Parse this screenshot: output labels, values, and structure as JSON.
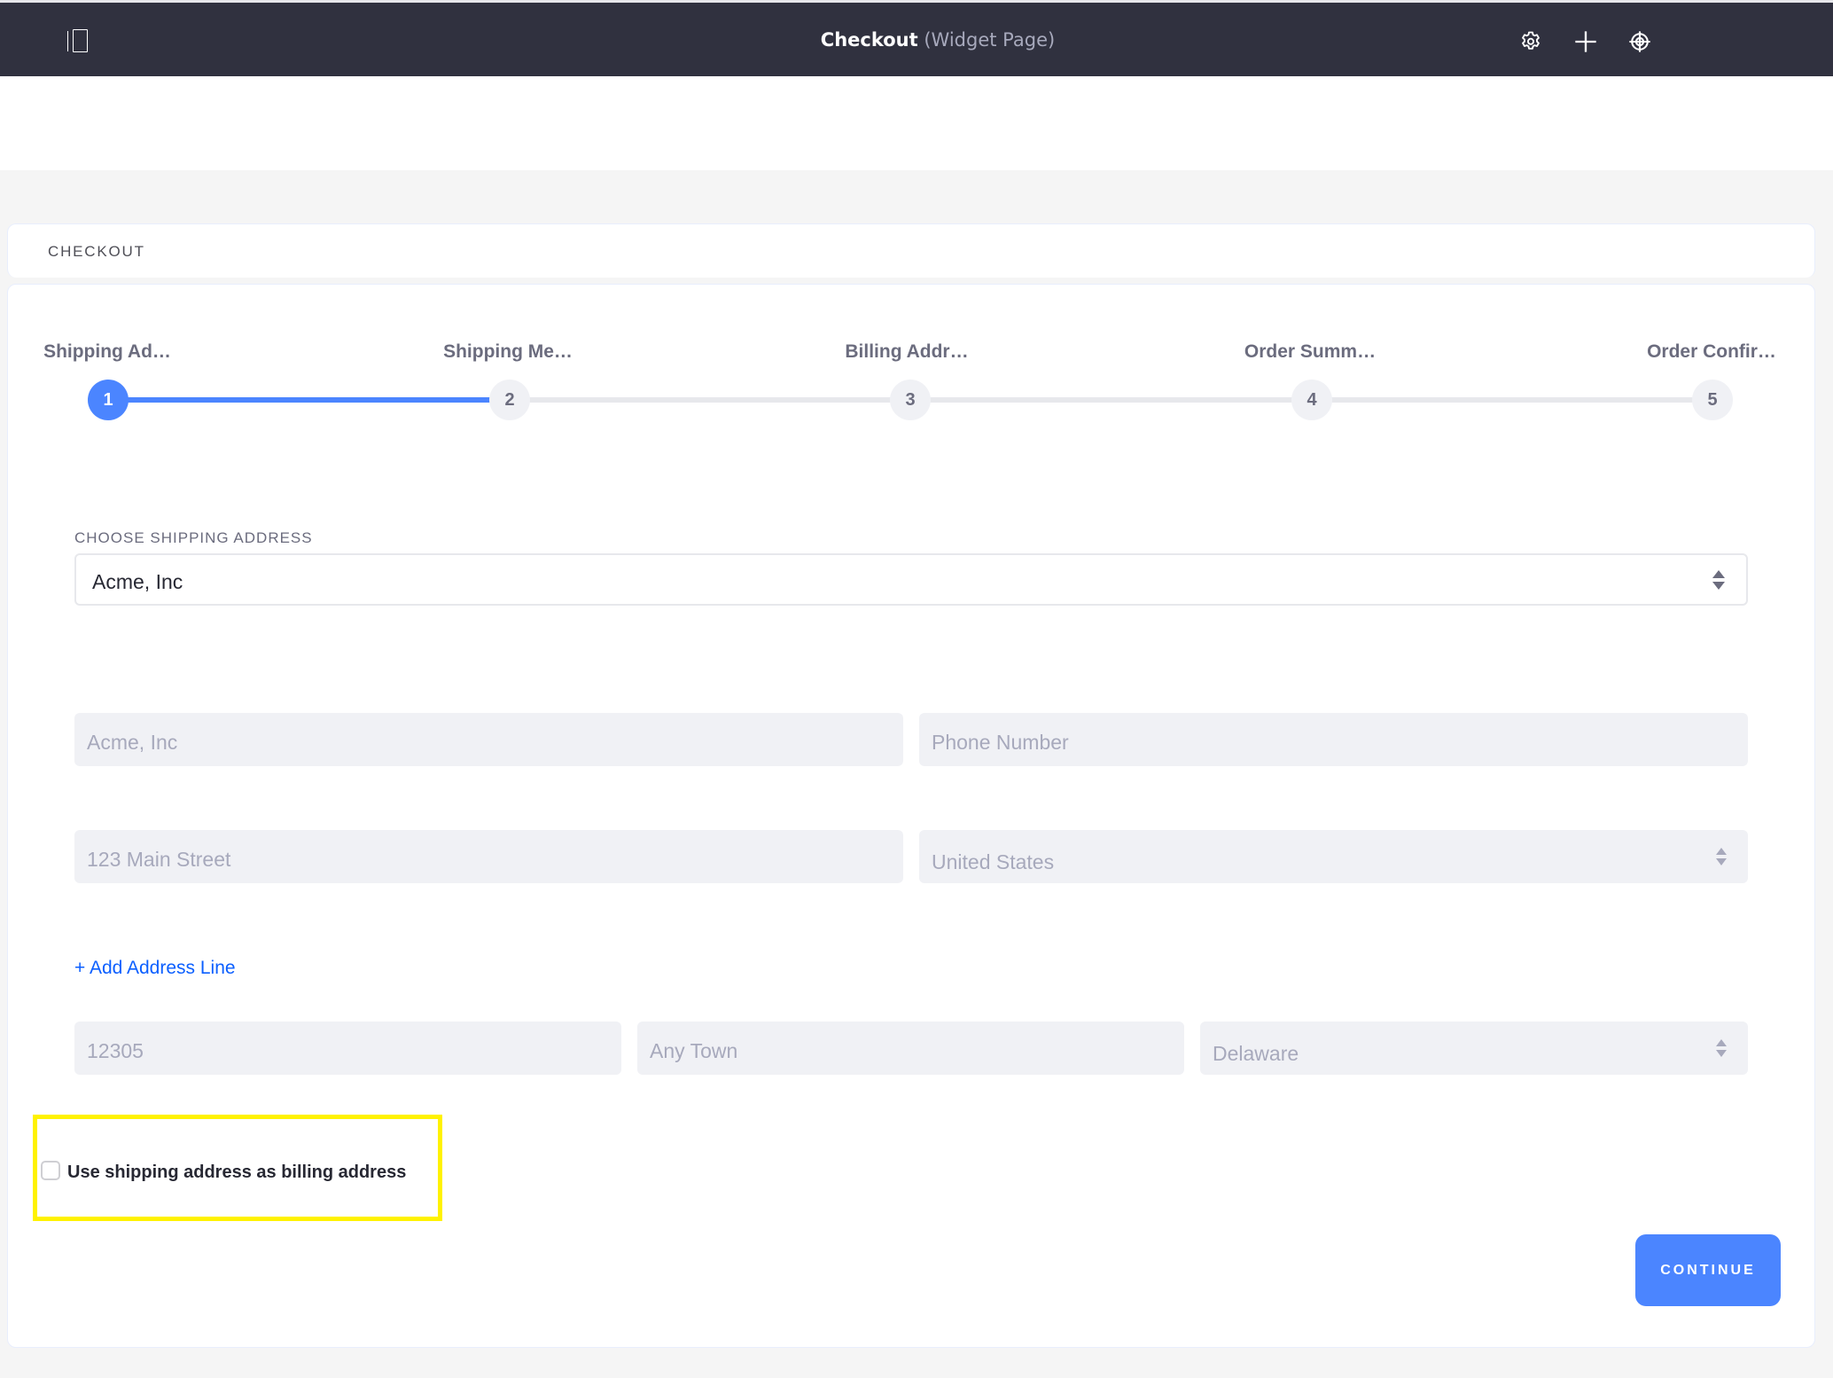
{
  "topbar": {
    "title": "Checkout",
    "subtitle": "(Widget Page)",
    "icons": [
      "sidebar-toggle-icon",
      "gear-icon",
      "plus-icon",
      "simulation-target-icon"
    ]
  },
  "header": {
    "title": "CHECKOUT"
  },
  "stepper": {
    "current_step": 1,
    "steps": [
      {
        "number": "1",
        "label": "Shipping Ad…"
      },
      {
        "number": "2",
        "label": "Shipping Me…"
      },
      {
        "number": "3",
        "label": "Billing Addr…"
      },
      {
        "number": "4",
        "label": "Order Summ…"
      },
      {
        "number": "5",
        "label": "Order Confir…"
      }
    ]
  },
  "form": {
    "choose_label": "CHOOSE SHIPPING ADDRESS",
    "choose_value": "Acme, Inc",
    "name": "Acme, Inc",
    "phone_placeholder": "Phone Number",
    "address": "123 Main Street",
    "country": "United States",
    "add_address_line": "+ Add Address Line",
    "zip": "12305",
    "city": "Any Town",
    "region": "Delaware",
    "use_as_billing_label": "Use shipping address as billing address",
    "use_as_billing_checked": false
  },
  "actions": {
    "continue_label": "CONTINUE"
  },
  "colors": {
    "topbar_bg": "#30313f",
    "accent": "#4b85ff",
    "link": "#0b5fff",
    "highlight": "#fff200"
  }
}
